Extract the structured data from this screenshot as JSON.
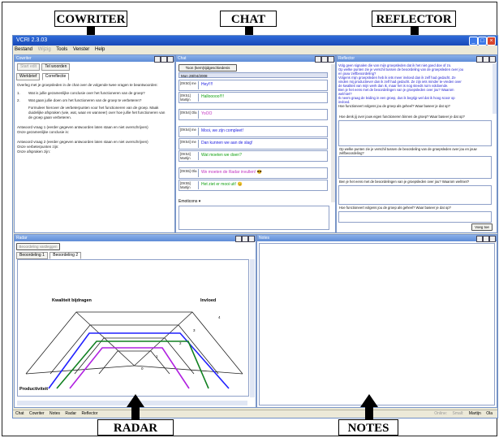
{
  "callouts": {
    "cowriter": "COWRITER",
    "chat": "CHAT",
    "reflector": "REFLECTOR",
    "radar": "RADAR",
    "notes": "NOTES"
  },
  "app": {
    "title": "VCRI 2.3.03",
    "menu": [
      "Bestand",
      "Wijzig",
      "Tools",
      "Venster",
      "Help"
    ]
  },
  "cowriter": {
    "title": "Cowriter",
    "buttons": [
      "Start edit",
      "Tel woorden"
    ],
    "tabs": [
      "Werkbrief",
      "Correflectie"
    ],
    "intro": "Overleg met je groepsleden in de chat over de volgende twee vragen te beantwoorden:",
    "q1_num": "1.",
    "q1": "Wat is jullie gezamenlijke conclusie over het functioneren van de groep?",
    "q2_num": "2.",
    "q2": "Wat gaan jullie doen om het functioneren van de groep te verbeteren?",
    "q2_note": "Formuleer hierover de verbeterpunten voor het functioneren van de groep. Maak duidelijke afspraken (wie, wat, waar en wanneer) over hoe jullie het functioneren van de groep gaan verbeteren.",
    "a1": "Antwoord vraag 1 (eerder gegeven antwoorden laten staan en niet overschrijven)",
    "a1_line": "Onze gezamenlijke conclusie is:",
    "a2": "Antwoord vraag 2 (eerder gegeven antwoorden laten staan en niet overschrijven)",
    "a2_line1": "Onze verbeterpunten zijn:",
    "a2_line2": "Onze afspraken zijn:"
  },
  "chat": {
    "title": "Chat",
    "toggle_button": "Toon (kern)tijdgeschiedenis",
    "date": "Mon 28/04/2008",
    "messages": [
      {
        "time": "[09:50] me",
        "author": "",
        "text": "Hey!!!!",
        "color": "#1a1ae0"
      },
      {
        "time": "[09:51]",
        "author": "Martijn",
        "text": "Hallooooo!!!!",
        "color": "#10a010"
      },
      {
        "time": "[09:54] Ola",
        "author": "",
        "text": "YoOO",
        "color": "#c030c0"
      },
      {
        "time": "[09:54] me",
        "author": "",
        "text": "Mooi, we zijn compleet!",
        "color": "#1a1ae0"
      },
      {
        "time": "[09:54] me",
        "author": "",
        "text": "Dan kunnen we aan de slag!",
        "color": "#1a1ae0"
      },
      {
        "time": "[09:54]",
        "author": "Martijn",
        "text": "Wat moeten we doen?",
        "color": "#10a010"
      },
      {
        "time": "[09:55] Ola",
        "author": "",
        "text": "We moeten de Radar invullen! 😎",
        "color": "#c030c0"
      },
      {
        "time": "[09:55]",
        "author": "Martijn",
        "text": "Het ziet er mooi uit! 😉",
        "color": "#10a010"
      }
    ],
    "emoticons": "Emoticons"
  },
  "reflector": {
    "title": "Reflector",
    "blue_lines": [
      "Volg geen signalen die van mijn groepsleden dat ik het niet goed doe of zo.",
      "Op welke punten zie je verschil tussen de beoordeling van de groepsleden over jou",
      "en jouw zelfbeoordeling?",
      "Volgens mijn groepsleden heb ik iets meer invloed dan ik zelf had gedacht. Ze",
      "vinden mij productiever dan ik zelf had gedacht. Ze zijn iets minder te-vreden over",
      "de kwaliteit van mijn werk dan ik, maar het is nog steeds ruim voldoende.",
      "Ben je het eens met de beoordelingen van je groepsleden over jou? Waarom",
      "wel/niet?",
      "Ik neem graag de leiding in een groep, dus ik begrijp wel dat ik hoog scoor op",
      "invloed."
    ],
    "black_lines": [
      "Hoe functioneert volgens jou de groep als geheel? Waar baseer je dat op?",
      "Hoe denk jij over jouw eigen functioneren binnen de groep? Waar baseer je dat op?"
    ],
    "q_diff": "Op welke punten zie je verschil tussen de beoordeling van de groepsleden over jou en jouw zelfbeoordeling?",
    "q_agree": "Ben je het eens met de beoordelingen van je groepsleden over jou? Waarom wel/niet?",
    "q_group": "Hoe functioneert volgens jou de groep als geheel? Waar baseer je dat op?",
    "submit": "Voeg toe"
  },
  "radar": {
    "title": "Radar",
    "top_button": "Beoordeling vastleggen",
    "tabs": [
      "Beoordeling 1",
      "Beoordeling 2"
    ],
    "labels": {
      "top_left": "Kwaliteit bijdragen",
      "top_right": "Invloed",
      "bottom_left": "Productiviteit"
    },
    "scale": [
      "0",
      "1",
      "2",
      "3",
      "4"
    ],
    "series_colors": [
      "#2020ff",
      "#108020",
      "#b020e0"
    ]
  },
  "notes": {
    "title": "Notes"
  },
  "statusbar": {
    "left": [
      "Chat",
      "Cowriter",
      "Notes",
      "Radar",
      "Reflector"
    ],
    "right": [
      "Online:",
      "Small:",
      "Martijn",
      "Ola"
    ]
  }
}
